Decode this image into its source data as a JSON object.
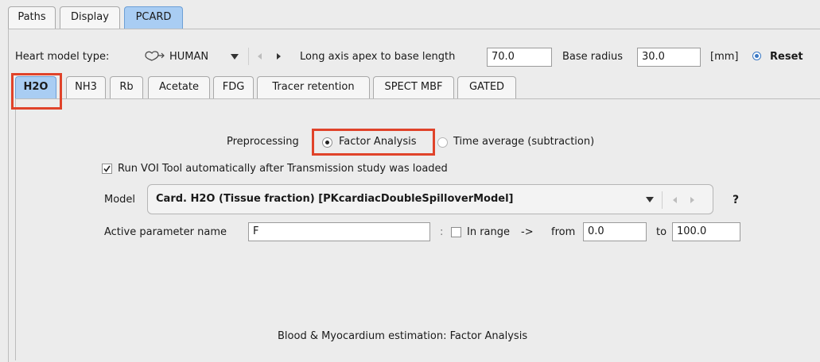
{
  "top_tabs": [
    "Paths",
    "Display",
    "PCARD"
  ],
  "heart_model": {
    "label": "Heart model type:",
    "value": "HUMAN",
    "apex_label": "Long axis apex to base length",
    "apex_value": "70.0",
    "radius_label": "Base radius",
    "radius_value": "30.0",
    "unit": "[mm]",
    "reset_label": "Reset"
  },
  "tracer_tabs": [
    "H2O",
    "NH3",
    "Rb",
    "Acetate",
    "FDG",
    "Tracer retention",
    "SPECT MBF",
    "GATED"
  ],
  "preprocessing": {
    "label": "Preprocessing",
    "option_factor": "Factor Analysis",
    "option_time": "Time average (subtraction)",
    "selected": "Factor Analysis"
  },
  "voi_tool": {
    "label": "Run VOI Tool automatically after Transmission study was loaded",
    "checked": true
  },
  "model": {
    "label": "Model",
    "value": "Card. H2O (Tissue fraction) [PKcardiacDoubleSpilloverModel]",
    "help": "?"
  },
  "active_param": {
    "label": "Active parameter name",
    "value": "F",
    "colon": ":",
    "in_range_label": "In range",
    "arrow": "->",
    "from_label": "from",
    "from_value": "0.0",
    "to_label": "to",
    "to_value": "100.0"
  },
  "status": "Blood & Myocardium estimation: Factor Analysis",
  "colors": {
    "highlight": "#e0432a",
    "active_tab": "#a9cdf3",
    "reset_dot": "#3a78c4"
  },
  "icons": [
    "heart-model-icon",
    "dropdown-arrow-icon",
    "prev-arrow-icon",
    "next-arrow-icon",
    "reset-radio-icon",
    "checkbox-checked-icon"
  ]
}
